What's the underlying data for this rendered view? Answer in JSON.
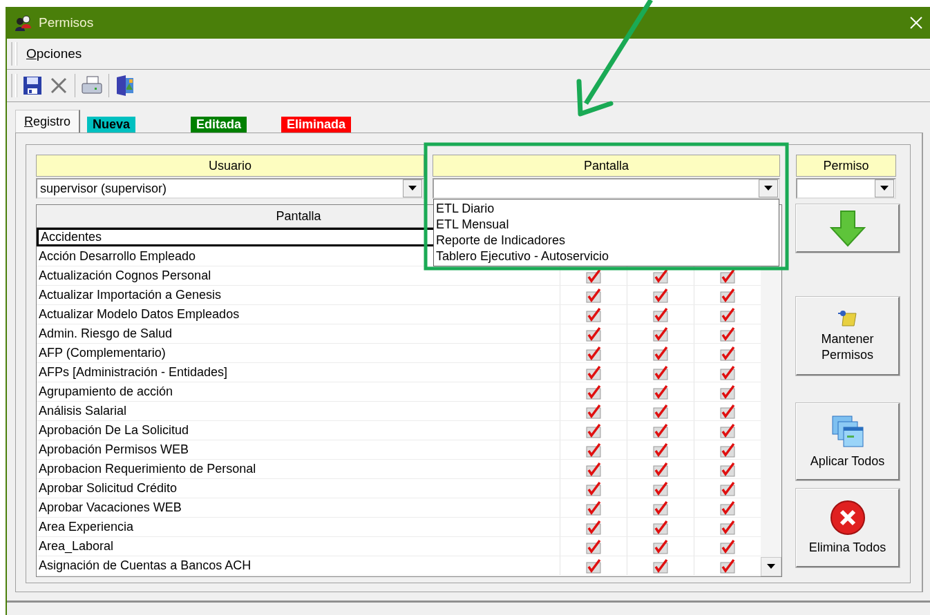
{
  "window": {
    "title": "Permisos"
  },
  "menu": [
    "Opciones"
  ],
  "toolbar": [
    {
      "kind": "save"
    },
    {
      "kind": "delete"
    },
    {
      "kind": "separator"
    },
    {
      "kind": "print"
    },
    {
      "kind": "separator"
    },
    {
      "kind": "exit"
    }
  ],
  "tabs": [
    {
      "label": "Registro",
      "selected": true
    }
  ],
  "legend": [
    {
      "label": "Nueva",
      "color": "#00c0c0"
    },
    {
      "label": "Editada",
      "color": "#008000"
    },
    {
      "label": "Eliminada",
      "color": "#ff0000"
    }
  ],
  "filters": [
    {
      "label": "Usuario",
      "value": "supervisor (supervisor)"
    },
    {
      "label": "Pantalla",
      "expanded": true,
      "options": [
        "ETL Diario",
        "ETL Mensual",
        "Reporte de Indicadores",
        "Tablero Ejecutivo - Autoservicio"
      ]
    },
    {
      "label": "Permiso"
    }
  ],
  "grid": {
    "columns": [
      "Pantalla"
    ],
    "rows": [
      {
        "name": "Accidentes",
        "selected": true
      },
      {
        "name": "Acción Desarrollo Empleado",
        "selected": false
      },
      {
        "name": "Actualización Cognos Personal",
        "selected": false,
        "checks": [
          true,
          true,
          true
        ]
      },
      {
        "name": "Actualizar Importación a Genesis",
        "selected": false,
        "checks": [
          true,
          true,
          true
        ]
      },
      {
        "name": "Actualizar Modelo Datos Empleados",
        "selected": false,
        "checks": [
          true,
          true,
          true
        ]
      },
      {
        "name": "Admin. Riesgo de Salud",
        "selected": false,
        "checks": [
          true,
          true,
          true
        ]
      },
      {
        "name": "AFP (Complementario)",
        "selected": false,
        "checks": [
          true,
          true,
          true
        ]
      },
      {
        "name": "AFPs [Administración - Entidades]",
        "selected": false,
        "checks": [
          true,
          true,
          true
        ]
      },
      {
        "name": "Agrupamiento de acción",
        "selected": false,
        "checks": [
          true,
          true,
          true
        ]
      },
      {
        "name": "Análisis Salarial",
        "selected": false,
        "checks": [
          true,
          true,
          true
        ]
      },
      {
        "name": "Aprobación De La Solicitud",
        "selected": false,
        "checks": [
          true,
          true,
          true
        ]
      },
      {
        "name": "Aprobación Permisos WEB",
        "selected": false,
        "checks": [
          true,
          true,
          true
        ]
      },
      {
        "name": "Aprobacion Requerimiento de Personal",
        "selected": false,
        "checks": [
          true,
          true,
          true
        ]
      },
      {
        "name": "Aprobar Solicitud Crédito",
        "selected": false,
        "checks": [
          true,
          true,
          true
        ]
      },
      {
        "name": "Aprobar Vacaciones WEB",
        "selected": false,
        "checks": [
          true,
          true,
          true
        ]
      },
      {
        "name": "Area Experiencia",
        "selected": false,
        "checks": [
          true,
          true,
          true
        ]
      },
      {
        "name": "Area_Laboral",
        "selected": false,
        "checks": [
          true,
          true,
          true
        ]
      },
      {
        "name": "Asignación de Cuentas a Bancos ACH",
        "selected": false,
        "checks": [
          true,
          true,
          true
        ]
      }
    ]
  },
  "actions": [
    {
      "kind": "add"
    },
    {
      "kind": "keep",
      "label": "Mantener Permisos"
    },
    {
      "kind": "apply",
      "label": "Aplicar Todos"
    },
    {
      "kind": "remove",
      "label": "Elimina Todos"
    }
  ],
  "annotation": {
    "kind": "arrow-frame"
  }
}
